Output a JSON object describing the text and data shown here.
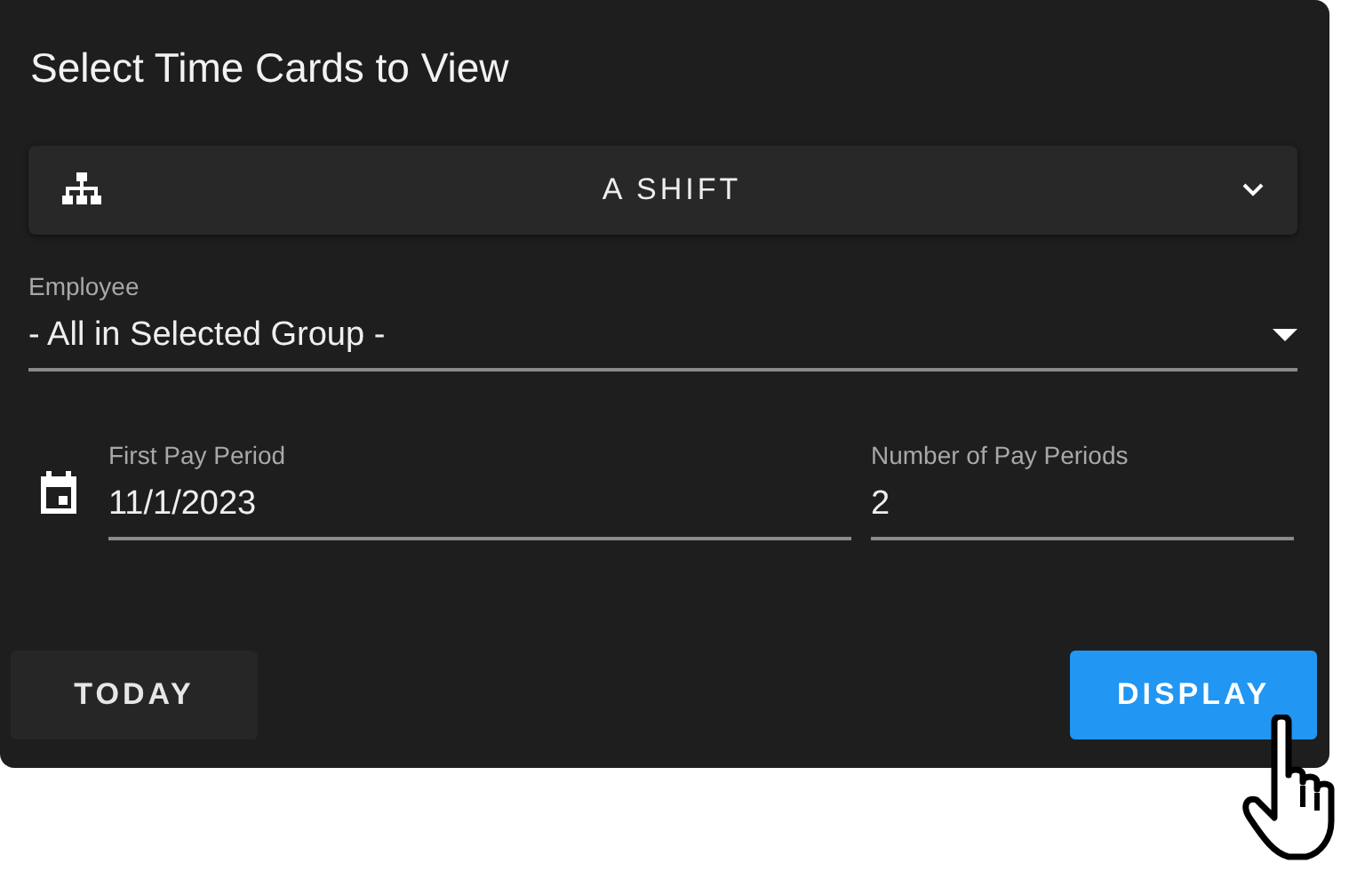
{
  "title": "Select Time Cards to View",
  "group_selector": {
    "value": "A SHIFT"
  },
  "employee": {
    "label": "Employee",
    "value": "- All in Selected Group -"
  },
  "first_pay_period": {
    "label": "First Pay Period",
    "value": "11/1/2023"
  },
  "pay_periods": {
    "label": "Number of Pay Periods",
    "value": "2"
  },
  "buttons": [
    {
      "label": "TODAY",
      "kind": "secondary"
    },
    {
      "label": "DISPLAY",
      "kind": "primary"
    }
  ]
}
